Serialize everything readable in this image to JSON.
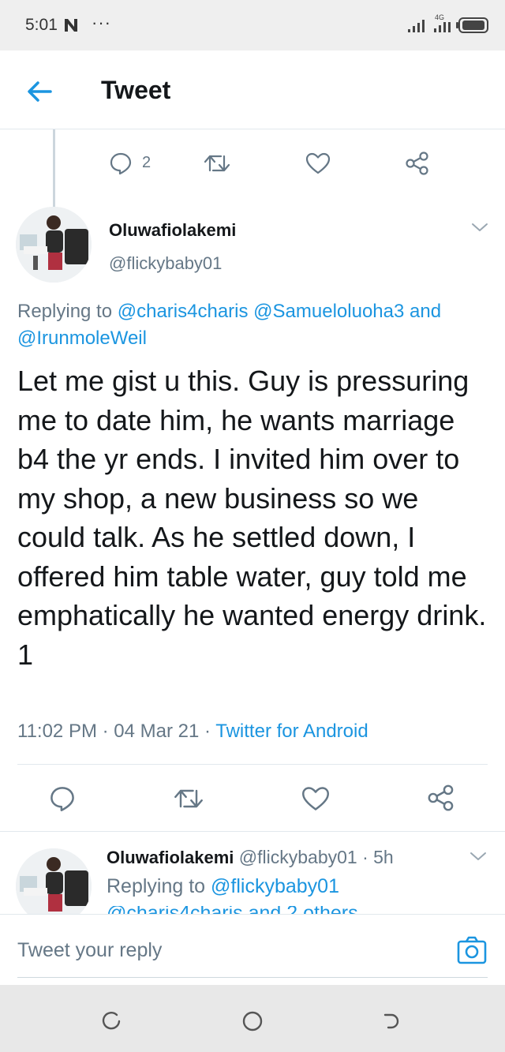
{
  "status": {
    "time": "5:01",
    "network": "4G"
  },
  "header": {
    "title": "Tweet"
  },
  "prev_tweet": {
    "reply_count": "2"
  },
  "tweet": {
    "name": "Oluwafiolakemi",
    "handle": "@flickybaby01",
    "replying_prefix": "Replying to",
    "replying_to_1": "@charis4charis",
    "replying_to_2": "@Samueloluoha3",
    "replying_and": "and",
    "replying_to_3": "@IrunmoleWeil",
    "text": "Let me gist u this. Guy is pressuring me to date him, he wants marriage b4 the yr ends. I invited him over to my shop, a new business so we could talk. As he settled down, I offered him table water, guy told me emphatically he wanted energy drink. 1",
    "time": "11:02 PM",
    "dot": "·",
    "date": "04 Mar 21",
    "source": "Twitter for Android"
  },
  "next_tweet": {
    "name": "Oluwafiolakemi",
    "handle": "@flickybaby01",
    "age": "· 5h",
    "replying_prefix": "Replying to",
    "replying_to": "@flickybaby01",
    "cut_line": "@charis4charis and 2 others"
  },
  "reply_bar": {
    "placeholder": "Tweet your reply"
  },
  "colors": {
    "accent": "#1b95e0",
    "muted": "#657786",
    "text": "#14171a"
  }
}
